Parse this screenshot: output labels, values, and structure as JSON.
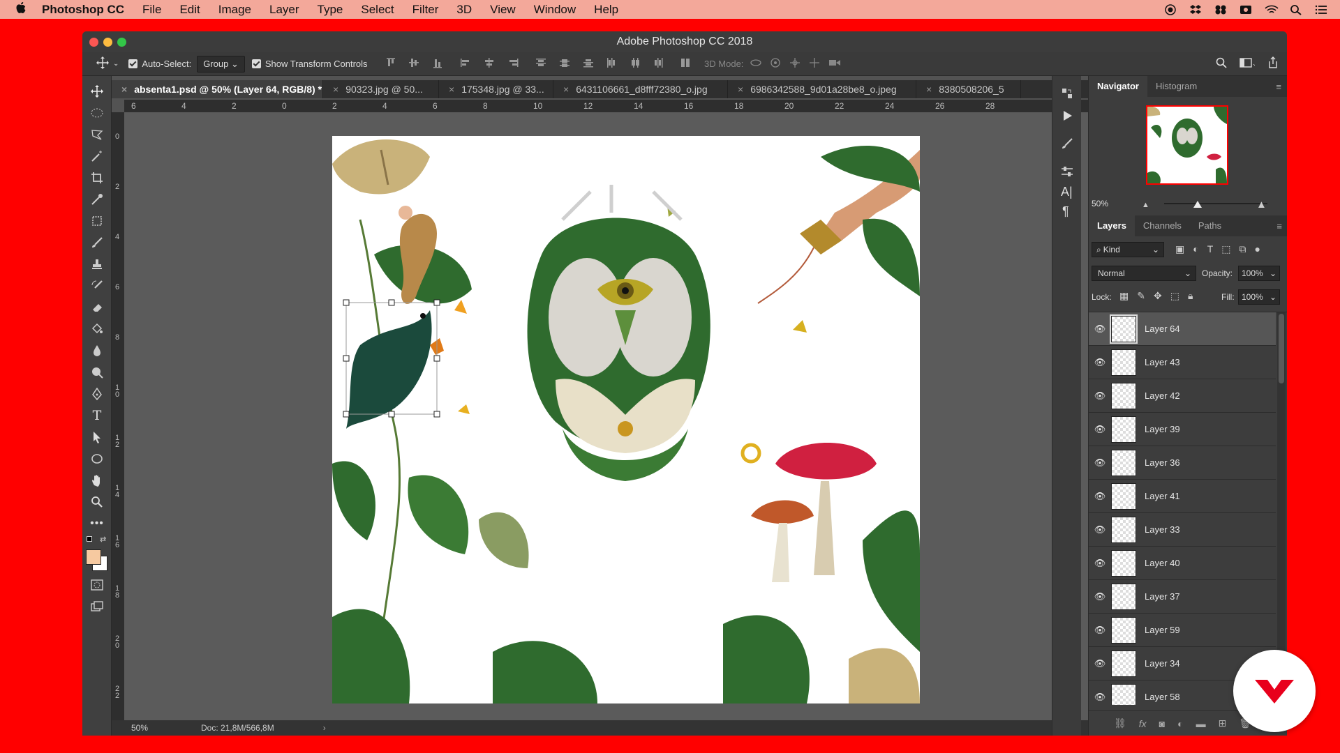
{
  "menubar": {
    "app_name": "Photoshop CC",
    "items": [
      "File",
      "Edit",
      "Image",
      "Layer",
      "Type",
      "Select",
      "Filter",
      "3D",
      "View",
      "Window",
      "Help"
    ]
  },
  "window": {
    "title": "Adobe Photoshop CC 2018"
  },
  "options_bar": {
    "auto_select_label": "Auto-Select:",
    "auto_select_value": "Group",
    "show_transform_label": "Show Transform Controls",
    "mode_3d_label": "3D Mode:"
  },
  "tabs": [
    {
      "label": "absenta1.psd @ 50% (Layer 64, RGB/8) *",
      "active": true
    },
    {
      "label": "90323.jpg @ 50...",
      "active": false
    },
    {
      "label": "175348.jpg @ 33...",
      "active": false
    },
    {
      "label": "6431106661_d8fff72380_o.jpg",
      "active": false
    },
    {
      "label": "6986342588_9d01a28be8_o.jpeg",
      "active": false
    },
    {
      "label": "8380508206_5",
      "active": false
    }
  ],
  "ruler": {
    "h_ticks": [
      "6",
      "4",
      "2",
      "0",
      "2",
      "4",
      "6",
      "8",
      "10",
      "12",
      "14",
      "16",
      "18",
      "20",
      "22",
      "24",
      "26",
      "28"
    ],
    "v_ticks": [
      "0",
      "2",
      "4",
      "6",
      "8",
      "1 0",
      "1 2",
      "1 4",
      "1 6",
      "1 8",
      "2 0",
      "2 2"
    ]
  },
  "status": {
    "zoom": "50%",
    "doc": "Doc: 21,8M/566,8M"
  },
  "navigator": {
    "tabs": [
      "Navigator",
      "Histogram"
    ],
    "zoom": "50%"
  },
  "layers_panel": {
    "tabs": [
      "Layers",
      "Channels",
      "Paths"
    ],
    "filter_kind": "Kind",
    "blend_mode": "Normal",
    "opacity_label": "Opacity:",
    "opacity_value": "100%",
    "lock_label": "Lock:",
    "fill_label": "Fill:",
    "fill_value": "100%",
    "layers": [
      {
        "name": "Layer 64",
        "active": true
      },
      {
        "name": "Layer 43",
        "active": false
      },
      {
        "name": "Layer 42",
        "active": false
      },
      {
        "name": "Layer 39",
        "active": false
      },
      {
        "name": "Layer 36",
        "active": false
      },
      {
        "name": "Layer 41",
        "active": false
      },
      {
        "name": "Layer 33",
        "active": false
      },
      {
        "name": "Layer 40",
        "active": false
      },
      {
        "name": "Layer 37",
        "active": false
      },
      {
        "name": "Layer 59",
        "active": false
      },
      {
        "name": "Layer 34",
        "active": false
      },
      {
        "name": "Layer 58",
        "active": false
      }
    ],
    "footer_fx": "fx"
  },
  "colors": {
    "background_red": "#ff0000",
    "foreground_swatch": "#f6c9a0",
    "background_swatch": "#ffffff",
    "nav_view_box": "#ff0000"
  }
}
